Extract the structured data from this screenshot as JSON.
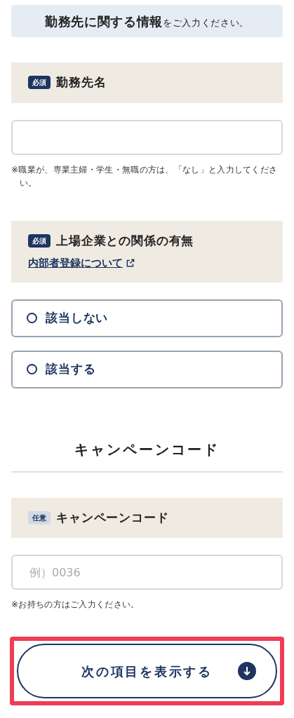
{
  "intro": {
    "text": "**勤務先に関する情報**をご入力ください。"
  },
  "sections": [
    {
      "kind": "text",
      "badge": "必須",
      "required": true,
      "label": "勤務先名",
      "note": "※職業が、専業主婦・学生・無職の方は、「なし」と入力してください。"
    },
    {
      "kind": "radio",
      "badge": "必須",
      "required": true,
      "label": "上場企業との関係の有無",
      "link": "内部者登録について",
      "options": [
        {
          "label": "該当しない",
          "selected": false
        },
        {
          "label": "該当する",
          "selected": false
        }
      ]
    },
    {
      "kind": "heading",
      "title": "キャンペーンコード"
    },
    {
      "kind": "text",
      "badge": "任意",
      "required": false,
      "label": "キャンペーンコード",
      "field": {
        "placeholder": "例）0036"
      },
      "note": "※お持ちの方はご入力ください。"
    }
  ],
  "next_button": {
    "label": "次の項目を表示する",
    "highlighted": true
  }
}
